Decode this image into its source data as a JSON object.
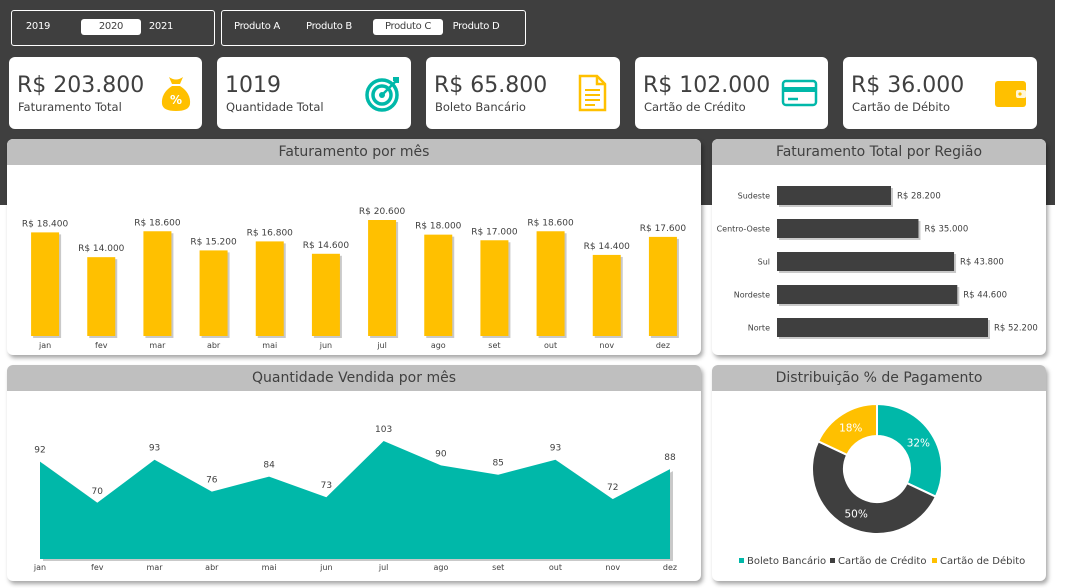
{
  "filters": {
    "years": [
      "2019",
      "2020",
      "2021"
    ],
    "selected_year": "2020",
    "products": [
      "Produto A",
      "Produto B",
      "Produto C",
      "Produto D"
    ],
    "selected_product": "Produto C"
  },
  "kpis": [
    {
      "value": "R$ 203.800",
      "label": "Faturamento Total",
      "icon": "money-bag-icon"
    },
    {
      "value": "1019",
      "label": "Quantidade Total",
      "icon": "target-icon"
    },
    {
      "value": "R$ 65.800",
      "label": "Boleto Bancário",
      "icon": "document-icon"
    },
    {
      "value": "R$ 102.000",
      "label": "Cartão de Crédito",
      "icon": "credit-card-icon"
    },
    {
      "value": "R$ 36.000",
      "label": "Cartão de Débito",
      "icon": "wallet-icon"
    }
  ],
  "colors": {
    "accent": "#ffc000",
    "teal": "#00b8a9",
    "dark": "#3f3f3f",
    "header": "#bfbfbf"
  },
  "chart_data": [
    {
      "type": "bar",
      "title": "Faturamento por mês",
      "categories": [
        "jan",
        "fev",
        "mar",
        "abr",
        "mai",
        "jun",
        "jul",
        "ago",
        "set",
        "out",
        "nov",
        "dez"
      ],
      "values": [
        18400,
        14000,
        18600,
        15200,
        16800,
        14600,
        20600,
        18000,
        17000,
        18600,
        14400,
        17600
      ],
      "data_labels": [
        "R$ 18.400",
        "R$ 14.000",
        "R$ 18.600",
        "R$ 15.200",
        "R$ 16.800",
        "R$ 14.600",
        "R$ 20.600",
        "R$ 18.000",
        "R$ 17.000",
        "R$ 18.600",
        "R$ 14.400",
        "R$ 17.600"
      ],
      "ylim": [
        0,
        20600
      ],
      "color": "#ffc000"
    },
    {
      "type": "bar",
      "orientation": "horizontal",
      "title": "Faturamento Total por Região",
      "categories": [
        "Sudeste",
        "Centro-Oeste",
        "Sul",
        "Nordeste",
        "Norte"
      ],
      "values": [
        28200,
        35000,
        43800,
        44600,
        52200
      ],
      "data_labels": [
        "R$ 28.200",
        "R$ 35.000",
        "R$ 43.800",
        "R$ 44.600",
        "R$ 52.200"
      ],
      "xlim": [
        0,
        52200
      ],
      "color": "#3f3f3f"
    },
    {
      "type": "area",
      "title": "Quantidade Vendida por mês",
      "categories": [
        "jan",
        "fev",
        "mar",
        "abr",
        "mai",
        "jun",
        "jul",
        "ago",
        "set",
        "out",
        "nov",
        "dez"
      ],
      "values": [
        92,
        70,
        93,
        76,
        84,
        73,
        103,
        90,
        85,
        93,
        72,
        88
      ],
      "ylim": [
        0,
        103
      ],
      "color": "#00b8a9"
    },
    {
      "type": "pie",
      "donut": true,
      "title": "Distribuição % de Pagamento",
      "slices": [
        {
          "name": "Boleto Bancário",
          "value": 32,
          "label": "32%",
          "color": "#00b8a9"
        },
        {
          "name": "Cartão de Crédito",
          "value": 50,
          "label": "50%",
          "color": "#3f3f3f"
        },
        {
          "name": "Cartão de Débito",
          "value": 18,
          "label": "18%",
          "color": "#ffc000"
        }
      ],
      "legend": "bottom"
    }
  ]
}
